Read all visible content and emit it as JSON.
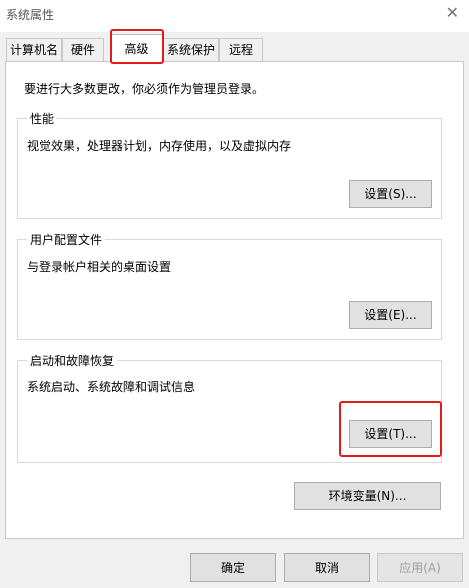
{
  "window": {
    "title": "系统属性",
    "close_glyph": "✕"
  },
  "tabs": [
    {
      "label": "计算机名"
    },
    {
      "label": "硬件"
    },
    {
      "label": "高级",
      "active": true
    },
    {
      "label": "系统保护"
    },
    {
      "label": "远程"
    }
  ],
  "notice": "要进行大多数更改，你必须作为管理员登录。",
  "performance": {
    "legend": "性能",
    "description": "视觉效果，处理器计划，内存使用，以及虚拟内存",
    "button": "设置(S)..."
  },
  "user_profiles": {
    "legend": "用户配置文件",
    "description": "与登录帐户相关的桌面设置",
    "button": "设置(E)..."
  },
  "startup_recovery": {
    "legend": "启动和故障恢复",
    "description": "系统启动、系统故障和调试信息",
    "button": "设置(T)..."
  },
  "env_button": "环境变量(N)...",
  "footer": {
    "ok": "确定",
    "cancel": "取消",
    "apply": "应用(A)"
  },
  "highlight_color": "#e21b1b"
}
